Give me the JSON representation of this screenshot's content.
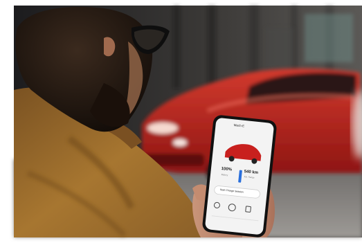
{
  "scene": {
    "description_labels": {
      "photo": "photo",
      "phone": "smartphone",
      "car": "vehicle"
    }
  },
  "phone_app": {
    "car_name": "Mach-E",
    "battery_percent": "100%",
    "range_value": "540 km",
    "range_label": "Est. Range",
    "battery_label": "Battery",
    "button_label": "Start Charge Session",
    "nav_labels": [
      "",
      "",
      ""
    ]
  },
  "colors": {
    "car_red": "#c8201e",
    "jacket": "#9a6a2c",
    "background_dark": "#2a2a2c",
    "phone_screen": "#f2f2f2"
  }
}
